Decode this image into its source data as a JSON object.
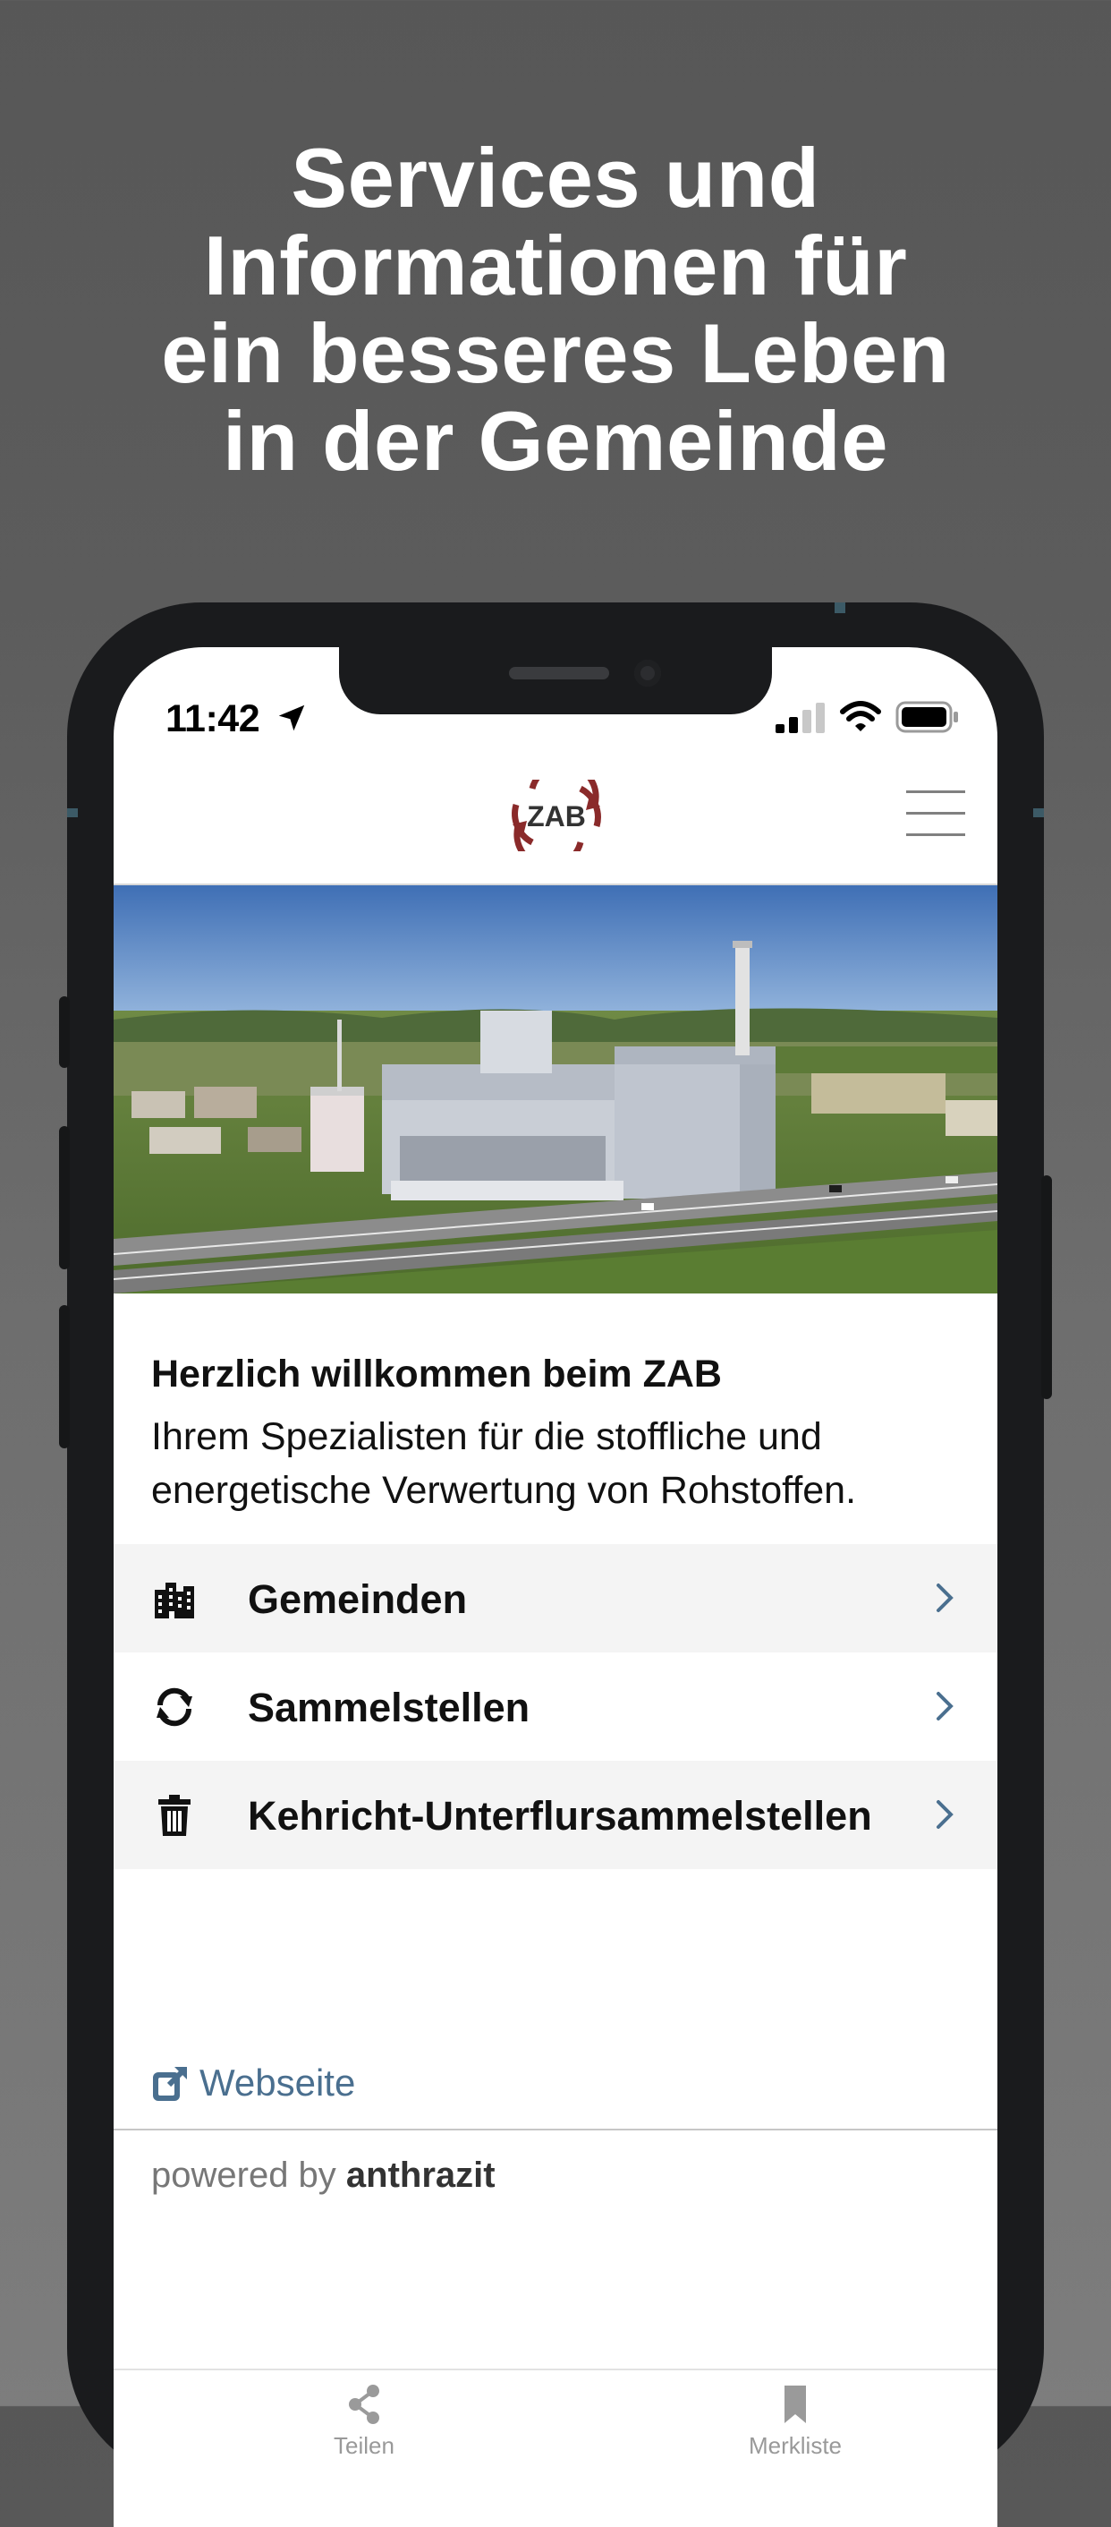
{
  "headline": {
    "lines": [
      "Services und",
      "Informationen für",
      "ein besseres Leben",
      "in der Gemeinde"
    ]
  },
  "status_bar": {
    "time": "11:42",
    "icons": [
      "location-arrow-icon",
      "signal-icon",
      "wifi-icon",
      "battery-icon"
    ]
  },
  "header": {
    "logo_text": "ZAB",
    "menu_icon": "hamburger-menu-icon",
    "brand_color": "#8a2a2a"
  },
  "hero": {
    "image": "aerial view of waste processing plant"
  },
  "welcome": {
    "title": "Herzlich willkommen beim ZAB",
    "text": "Ihrem Spezialisten für die stoffliche und energetische Verwertung von Rohstoffen."
  },
  "menu_items": [
    {
      "label": "Gemeinden",
      "icon": "buildings-icon"
    },
    {
      "label": "Sammelstellen",
      "icon": "recycle-arrows-icon"
    },
    {
      "label": "Kehricht-Unterflursammelstellen",
      "icon": "trash-icon"
    }
  ],
  "footer": {
    "website_label": "Webseite",
    "powered_prefix": "powered by",
    "powered_brand": "anthrazit",
    "link_color": "#4a6f8f"
  },
  "tabs": [
    {
      "label": "Teilen",
      "icon": "share-icon"
    },
    {
      "label": "Merkliste",
      "icon": "bookmark-icon"
    }
  ]
}
